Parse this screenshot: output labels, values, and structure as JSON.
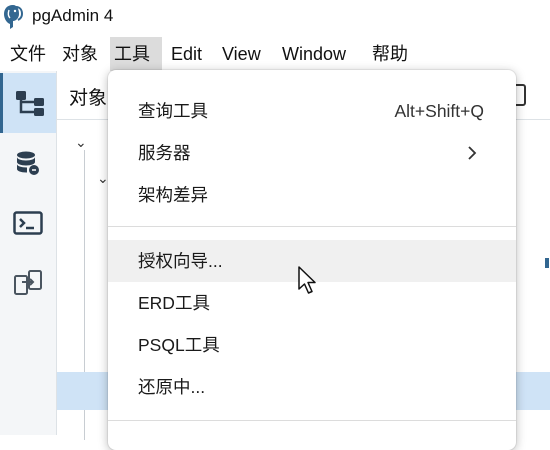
{
  "app": {
    "title": "pgAdmin 4"
  },
  "menubar": {
    "items": [
      {
        "label": "文件"
      },
      {
        "label": "对象"
      },
      {
        "label": "工具"
      },
      {
        "label": "Edit"
      },
      {
        "label": "View"
      },
      {
        "label": "Window"
      },
      {
        "label": "帮助"
      }
    ],
    "active_index": 2
  },
  "panel": {
    "title": "对象"
  },
  "tools_menu": {
    "items": [
      {
        "label": "查询工具",
        "shortcut": "Alt+Shift+Q"
      },
      {
        "label": "服务器",
        "submenu": true
      },
      {
        "label": "架构差异"
      },
      {
        "label": "授权向导..."
      },
      {
        "label": "ERD工具"
      },
      {
        "label": "PSQL工具"
      },
      {
        "label": "还原中..."
      }
    ],
    "hovered_index": 3
  },
  "colors": {
    "accent": "#326690",
    "selected_bg": "#cfe3f6",
    "hover_bg": "#f0f0f0"
  }
}
